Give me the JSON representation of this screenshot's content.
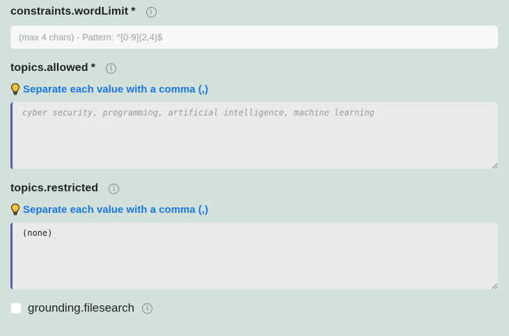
{
  "fields": {
    "word_limit": {
      "label": "constraints.wordLimit",
      "required_mark": "*",
      "info_glyph": "i",
      "placeholder": "(max 4 chars) - Pattern: ^[0-9]{2,4}$",
      "value": ""
    },
    "topics_allowed": {
      "label": "topics.allowed",
      "required_mark": "*",
      "info_glyph": "i",
      "hint": "Separate each value with a comma (,)",
      "placeholder": "cyber security, programming, artificial intelligence, machine learning",
      "value": ""
    },
    "topics_restricted": {
      "label": "topics.restricted",
      "info_glyph": "i",
      "hint": "Separate each value with a comma (,)",
      "value": "(none)"
    },
    "grounding_filesearch": {
      "label": "grounding.filesearch",
      "info_glyph": "i",
      "checked": false
    }
  },
  "colors": {
    "background": "#d4e1db",
    "hint_text": "#1976e8",
    "textarea_accent": "#5b55d6",
    "bulb": "#f2b51c"
  },
  "icons": [
    "info-icon",
    "lightbulb-icon",
    "resize-grip-icon"
  ]
}
